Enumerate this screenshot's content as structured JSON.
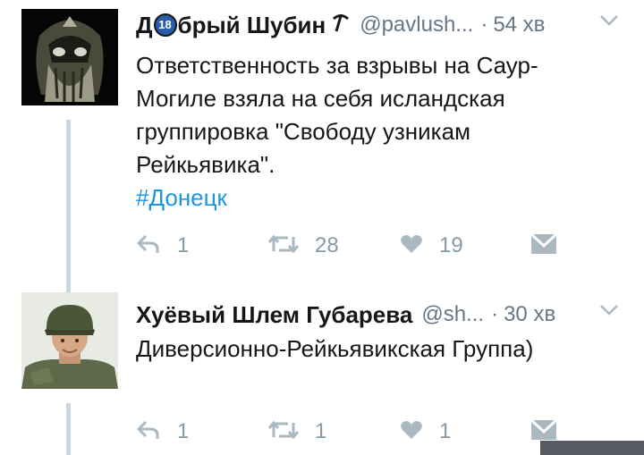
{
  "tweets": [
    {
      "name_prefix": "Д",
      "name_badge": "18",
      "name_suffix": "брый Шубин",
      "handle": "@pavlush...",
      "dot": "·",
      "time": "54 хв",
      "text_lines": [
        "Ответственность за взрывы на Саур-",
        "Могиле взяла на себя исландская",
        "группировка \"Свободу узникам",
        "Рейкьявика\"."
      ],
      "hashtag": "#Донецк",
      "replies": "1",
      "retweets": "28",
      "likes": "19"
    },
    {
      "name": "Хуёвый Шлем Губарева",
      "handle": "@sh...",
      "dot": "·",
      "time": "30 хв",
      "text": "Диверсионно-Рейкьявикская Группа)",
      "replies": "1",
      "retweets": "1",
      "likes": "1"
    }
  ],
  "colors": {
    "text": "#14171a",
    "secondary": "#657786",
    "action": "#8899a6",
    "link": "#1b95e0",
    "thread": "#ccd6dd"
  },
  "icons": [
    "reply-icon",
    "retweet-icon",
    "like-icon",
    "message-icon",
    "chevron-down-icon",
    "pickaxe-icon"
  ]
}
